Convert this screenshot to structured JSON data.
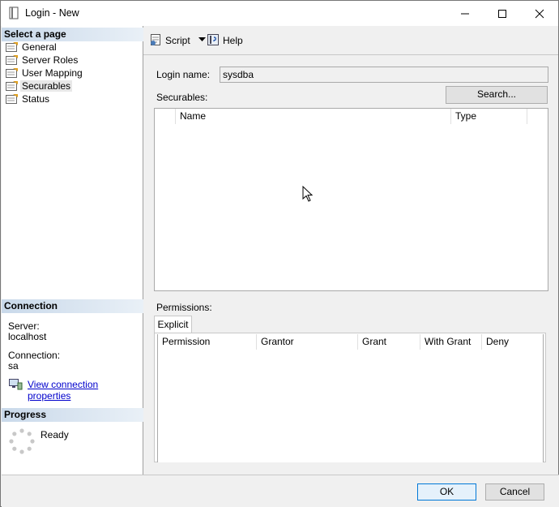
{
  "window": {
    "title": "Login - New"
  },
  "left_panel": {
    "select_page_header": "Select a page",
    "pages": [
      {
        "label": "General"
      },
      {
        "label": "Server Roles"
      },
      {
        "label": "User Mapping"
      },
      {
        "label": "Securables",
        "selected": true
      },
      {
        "label": "Status"
      }
    ],
    "connection": {
      "header": "Connection",
      "server_label": "Server:",
      "server_value": "localhost",
      "connection_label": "Connection:",
      "connection_value": "sa",
      "link_text": "View connection properties"
    },
    "progress": {
      "header": "Progress",
      "status": "Ready"
    }
  },
  "toolbar": {
    "script_label": "Script",
    "help_label": "Help"
  },
  "form": {
    "login_name_label": "Login name:",
    "login_name_value": "sysdba",
    "search_button": "Search...",
    "securables_label": "Securables:",
    "securables_columns": [
      "Name",
      "Type"
    ],
    "permissions_label": "Permissions:",
    "permissions_tab": "Explicit",
    "permissions_columns": [
      "Permission",
      "Grantor",
      "Grant",
      "With Grant",
      "Deny"
    ]
  },
  "footer": {
    "ok_label": "OK",
    "cancel_label": "Cancel"
  },
  "colors": {
    "section_header": "#c9d9ea",
    "link": "#0000cc",
    "ok_border": "#0078d7"
  }
}
